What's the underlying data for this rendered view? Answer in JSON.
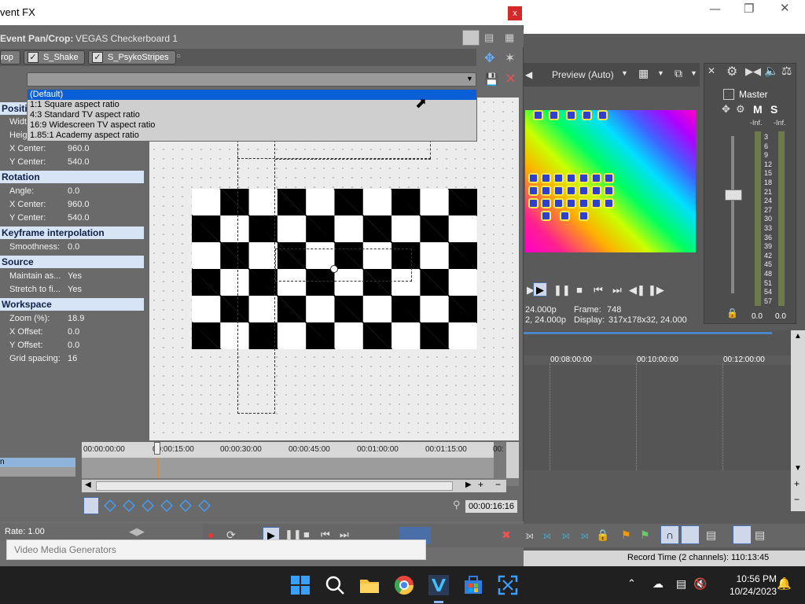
{
  "main_window": {
    "preview_label": "Preview (Auto)",
    "mixer_master": "Master",
    "mixer_m": "M",
    "mixer_s": "S",
    "mixer_inf_left": "-Inf.",
    "mixer_inf_right": "-Inf.",
    "meter_scale": [
      "3",
      "6",
      "9",
      "12",
      "15",
      "18",
      "21",
      "24",
      "27",
      "30",
      "33",
      "36",
      "39",
      "42",
      "45",
      "48",
      "51",
      "54",
      "57"
    ],
    "mixer_level_left": "0.0",
    "mixer_level_right": "0.0",
    "preview_info": {
      "fps_line": "24.000p",
      "frame_label": "Frame:",
      "frame_value": "748",
      "res_line": "2, 24.000p",
      "display_label": "Display:",
      "display_value": "317x178x32, 24.000"
    },
    "timeline_ticks": [
      "00:08:00:00",
      "00:10:00:00",
      "00:12:00:00"
    ],
    "record_time": "Record Time (2 channels): 110:13:45"
  },
  "dialog": {
    "title": "vent FX",
    "close_label": "x",
    "chain_label": "Event Pan/Crop:",
    "chain_value": "VEGAS Checkerboard 1",
    "plugins": [
      "rop",
      "S_Shake",
      "S_PsykoStripes"
    ],
    "dropdown_options": [
      "(Default)",
      "1:1 Square aspect ratio",
      "4:3 Standard TV aspect ratio",
      "16:9 Widescreen TV aspect ratio",
      "1.85:1 Academy aspect ratio"
    ],
    "sections": {
      "position": "Positi",
      "rotation": "Rotation",
      "keyframe": "Keyframe interpolation",
      "source": "Source",
      "workspace": "Workspace"
    },
    "position_rows": [
      {
        "label": "Widt",
        "value": ""
      },
      {
        "label": "Heig",
        "value": ""
      },
      {
        "label": "X Center:",
        "value": "960.0"
      },
      {
        "label": "Y Center:",
        "value": "540.0"
      }
    ],
    "rotation_rows": [
      {
        "label": "Angle:",
        "value": "0.0"
      },
      {
        "label": "X Center:",
        "value": "960.0"
      },
      {
        "label": "Y Center:",
        "value": "540.0"
      }
    ],
    "keyframe_rows": [
      {
        "label": "Smoothness:",
        "value": "0.0"
      }
    ],
    "source_rows": [
      {
        "label": "Maintain as...",
        "value": "Yes"
      },
      {
        "label": "Stretch to fi...",
        "value": "Yes"
      }
    ],
    "workspace_rows": [
      {
        "label": "Zoom (%):",
        "value": "18.9"
      },
      {
        "label": "X Offset:",
        "value": "0.0"
      },
      {
        "label": "Y Offset:",
        "value": "0.0"
      },
      {
        "label": "Grid spacing:",
        "value": "16"
      }
    ],
    "ruler_ticks": [
      "00:00:00:00",
      "00:00:15:00",
      "00:00:30:00",
      "00:00:45:00",
      "00:01:00:00",
      "00:01:15:00",
      "00:"
    ],
    "track_label_1": "n",
    "time_readout": "00:00:16:16",
    "rate": "Rate: 1.00"
  },
  "tooltip": "Video Media Generators",
  "taskbar": {
    "time": "10:56 PM",
    "date": "10/24/2023"
  }
}
